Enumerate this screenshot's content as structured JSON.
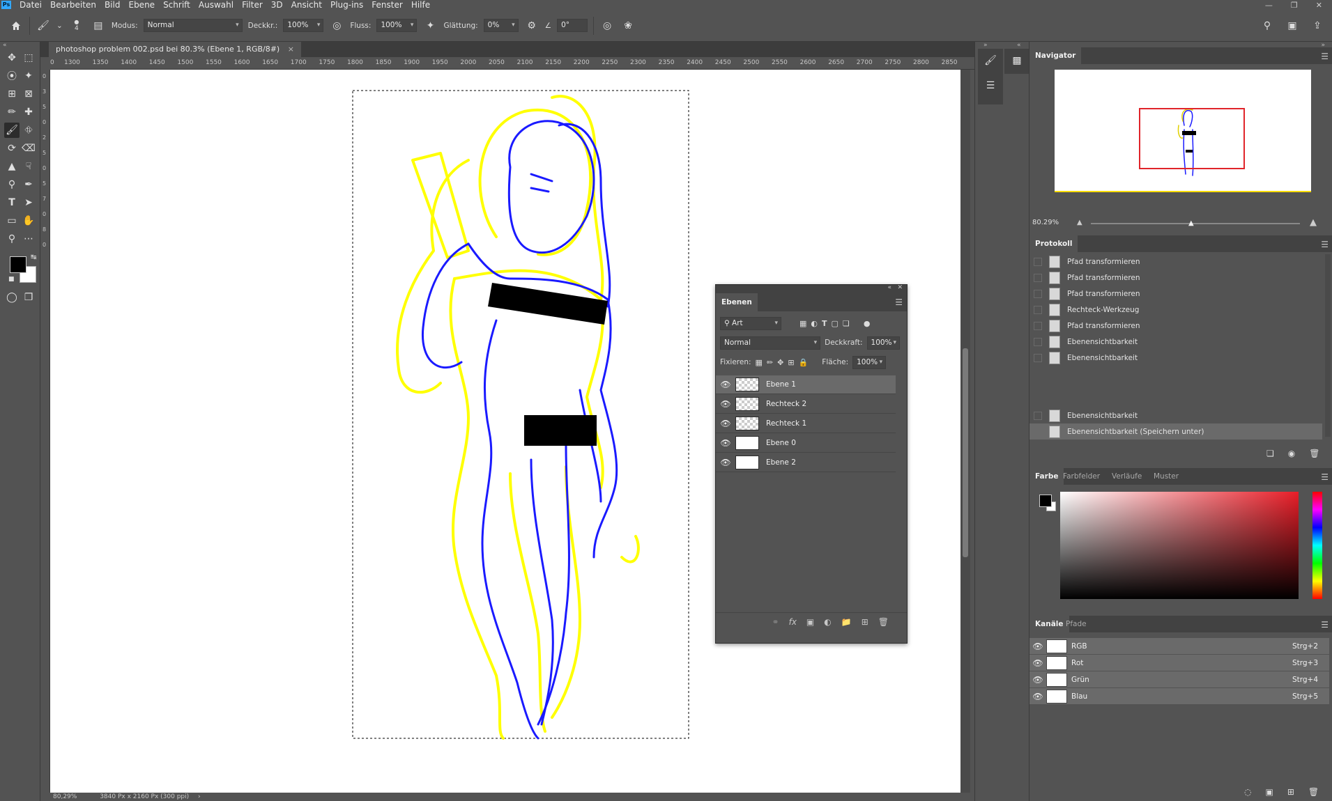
{
  "menubar": {
    "logo": "Ps",
    "items": [
      "Datei",
      "Bearbeiten",
      "Bild",
      "Ebene",
      "Schrift",
      "Auswahl",
      "Filter",
      "3D",
      "Ansicht",
      "Plug-ins",
      "Fenster",
      "Hilfe"
    ]
  },
  "options": {
    "brush_size": "4",
    "modus_label": "Modus:",
    "modus_value": "Normal",
    "deckkraft_label": "Deckkr.:",
    "deckkraft_value": "100%",
    "fluss_label": "Fluss:",
    "fluss_value": "100%",
    "glaettung_label": "Glättung:",
    "glaettung_value": "0%",
    "angle_value": "0°"
  },
  "document": {
    "tab_title": "photoshop problem 002.psd bei 80.3% (Ebene 1, RGB/8#)",
    "close": "×",
    "zoom": "80,29%",
    "size_info": "3840 Px x 2160 Px (300 ppi)"
  },
  "ruler": {
    "top_ticks": [
      "0",
      "1300",
      "1350",
      "1400",
      "1450",
      "1500",
      "1550",
      "1600",
      "1650",
      "1700",
      "1750",
      "1800",
      "1850",
      "1900",
      "1950",
      "2000",
      "2050",
      "2100",
      "2150",
      "2200",
      "2250",
      "2300",
      "2350",
      "2400",
      "2450",
      "2500",
      "2550",
      "2600",
      "2650",
      "2700",
      "2750",
      "2800",
      "2850"
    ]
  },
  "navigator": {
    "tab": "Navigator",
    "zoom": "80.29%"
  },
  "protokoll": {
    "tab": "Protokoll",
    "items": [
      "Pfad transformieren",
      "Pfad transformieren",
      "Pfad transformieren",
      "Rechteck-Werkzeug",
      "Pfad transformieren",
      "Ebenensichtbarkeit",
      "Ebenensichtbarkeit",
      "Ebenensichtbarkeit",
      "Ebenensichtbarkeit (Speichern unter)"
    ]
  },
  "color_panel": {
    "tabs": [
      "Farbe",
      "Farbfelder",
      "Verläufe",
      "Muster"
    ]
  },
  "channels": {
    "tabs": [
      "Kanäle",
      "Pfade"
    ],
    "rows": [
      {
        "label": "RGB",
        "key": "Strg+2"
      },
      {
        "label": "Rot",
        "key": "Strg+3"
      },
      {
        "label": "Grün",
        "key": "Strg+4"
      },
      {
        "label": "Blau",
        "key": "Strg+5"
      }
    ]
  },
  "layers": {
    "tab": "Ebenen",
    "filter_value": "Art",
    "blend_mode": "Normal",
    "deckkraft_label": "Deckkraft:",
    "deckkraft_value": "100%",
    "fixieren_label": "Fixieren:",
    "flaeche_label": "Fläche:",
    "flaeche_value": "100%",
    "rows": [
      {
        "label": "Ebene 1"
      },
      {
        "label": "Rechteck 2"
      },
      {
        "label": "Rechteck 1"
      },
      {
        "label": "Ebene 0"
      },
      {
        "label": "Ebene 2"
      }
    ]
  },
  "colors": {
    "ui_bg": "#535353",
    "panel_dark": "#424242",
    "selected_row": "#6a6a6a",
    "sketch_yellow": "#ffff00",
    "sketch_blue": "#1a1aff",
    "nav_frame": "#e0242a"
  }
}
